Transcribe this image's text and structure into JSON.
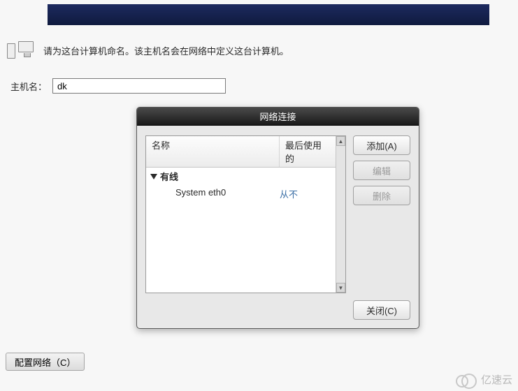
{
  "instruction_text": "请为这台计算机命名。该主机名会在网络中定义这台计算机。",
  "hostname": {
    "label": "主机名：",
    "value": "dk"
  },
  "dialog": {
    "title": "网络连接",
    "columns": {
      "name": "名称",
      "last_used": "最后使用的"
    },
    "group_label": "有线",
    "connections": [
      {
        "name": "System eth0",
        "last_used": "从不"
      }
    ],
    "buttons": {
      "add": "添加(A)",
      "edit": "编辑",
      "delete": "删除",
      "close": "关闭(C)"
    }
  },
  "config_button_label": "配置网络（C）",
  "watermark_text": "亿速云"
}
